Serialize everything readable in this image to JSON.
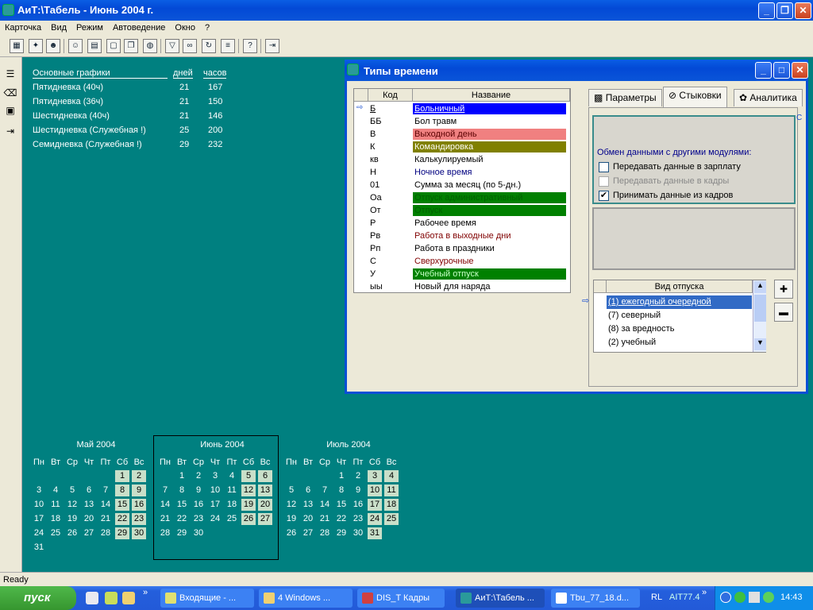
{
  "app": {
    "title": "АиТ:\\Табель - Июнь 2004 г."
  },
  "menu": [
    "Карточка",
    "Вид",
    "Режим",
    "Автоведение",
    "Окно",
    "?"
  ],
  "schedules": {
    "headers": [
      "Основные графики",
      "дней",
      "часов"
    ],
    "rows": [
      {
        "name": "Пятидневка (40ч)",
        "days": "21",
        "hours": "167"
      },
      {
        "name": "Пятидневка (36ч)",
        "days": "21",
        "hours": "150"
      },
      {
        "name": "Шестидневка (40ч)",
        "days": "21",
        "hours": "146"
      },
      {
        "name": "Шестидневка (Служебная !)",
        "days": "25",
        "hours": "200"
      },
      {
        "name": "Семидневка (Служебная !)",
        "days": "29",
        "hours": "232"
      }
    ]
  },
  "dialog": {
    "title": "Типы времени",
    "grid_headers": [
      "Код",
      "Название"
    ],
    "rows": [
      {
        "code": "Б",
        "name": "Больничный",
        "bg": "#0000ff",
        "fg": "#ffffff",
        "sel": true
      },
      {
        "code": "ББ",
        "name": "Бол травм",
        "bg": "#ffffff",
        "fg": "#000000"
      },
      {
        "code": "В",
        "name": "Выходной день",
        "bg": "#f08080",
        "fg": "#5a0000"
      },
      {
        "code": "К",
        "name": "Командировка",
        "bg": "#808000",
        "fg": "#ffffff"
      },
      {
        "code": "кв",
        "name": "Калькулируемый",
        "bg": "#ffffff",
        "fg": "#000000"
      },
      {
        "code": "Н",
        "name": "Ночное время",
        "bg": "#ffffff",
        "fg": "#000080"
      },
      {
        "code": "01",
        "name": "Сумма за месяц (по 5-дн.)",
        "bg": "#ffffff",
        "fg": "#000000"
      },
      {
        "code": "Оа",
        "name": "Отпуск административный",
        "bg": "#008000",
        "fg": "#006000"
      },
      {
        "code": "От",
        "name": "Отпуск",
        "bg": "#008000",
        "fg": "#006000"
      },
      {
        "code": "Р",
        "name": "Рабочее время",
        "bg": "#ffffff",
        "fg": "#000000"
      },
      {
        "code": "Рв",
        "name": "Работа в выходные дни",
        "bg": "#ffffff",
        "fg": "#800000"
      },
      {
        "code": "Рп",
        "name": "Работа в праздники",
        "bg": "#ffffff",
        "fg": "#000000"
      },
      {
        "code": "С",
        "name": "Сверхурочные",
        "bg": "#ffffff",
        "fg": "#800000"
      },
      {
        "code": "У",
        "name": "Учебный отпуск",
        "bg": "#008000",
        "fg": "#c8ffc8"
      },
      {
        "code": "ыы",
        "name": "Новый для наряда",
        "bg": "#ffffff",
        "fg": "#000000"
      }
    ],
    "tabs": [
      "Параметры",
      "Стыковки",
      "Аналитика"
    ],
    "exchange_label": "Обмен данными с другими модулями:",
    "checks": [
      {
        "label": "Передавать данные в зарплату",
        "checked": false,
        "disabled": false
      },
      {
        "label": "Передавать данные в кадры",
        "checked": false,
        "disabled": true
      },
      {
        "label": "Принимать данные из кадров",
        "checked": true,
        "disabled": false
      }
    ],
    "vacation_header": "Вид отпуска",
    "vacations": [
      "(1) ежегодный очередной",
      "(7) северный",
      "(8) за вредность",
      "(2) учебный"
    ]
  },
  "calendars": [
    {
      "month": "Май 2004",
      "start": 5,
      "days": 31
    },
    {
      "month": "Июнь 2004",
      "start": 1,
      "days": 30
    },
    {
      "month": "Июль 2004",
      "start": 3,
      "days": 31
    }
  ],
  "weekdays": [
    "Пн",
    "Вт",
    "Ср",
    "Чт",
    "Пт",
    "Сб",
    "Вс"
  ],
  "status": "Ready",
  "taskbar": {
    "start": "пуск",
    "tasks": [
      "Входящие - ...",
      "4 Windows ...",
      "DIS_T Кадры",
      "АиТ:\\Табель ...",
      "Tbu_77_18.d..."
    ],
    "lang": "RL",
    "app_tag": "AIT77.4",
    "clock": "14:43"
  }
}
